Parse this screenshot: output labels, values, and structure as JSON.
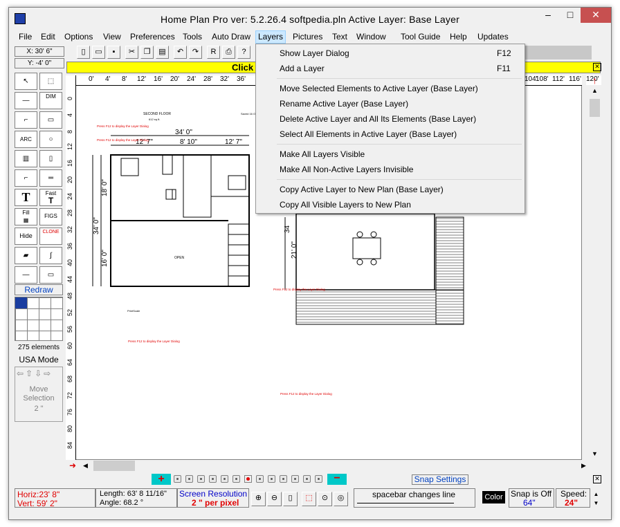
{
  "window": {
    "title": "Home Plan Pro ver: 5.2.26.4    softpedia.pln        Active Layer: Base Layer",
    "controls": {
      "minimize": "–",
      "maximize": "□",
      "close": "✕"
    }
  },
  "menu": [
    {
      "label": "File"
    },
    {
      "label": "Edit"
    },
    {
      "label": "Options"
    },
    {
      "label": "View"
    },
    {
      "label": "Preferences"
    },
    {
      "label": "Tools"
    },
    {
      "label": "Auto Draw"
    },
    {
      "label": "Layers"
    },
    {
      "label": "Pictures"
    },
    {
      "label": "Text"
    },
    {
      "label": "Window"
    },
    {
      "label": "Tool Guide"
    },
    {
      "label": "Help"
    },
    {
      "label": "Updates"
    }
  ],
  "coords": {
    "x": "X: 30' 6\"",
    "y": "Y: -4' 0\""
  },
  "banner": {
    "text": "Click o"
  },
  "layers_menu": [
    {
      "label": "Show Layer Dialog",
      "shortcut": "F12"
    },
    {
      "label": "Add a Layer",
      "shortcut": "F11"
    },
    {
      "label": "Move Selected Elements to Active Layer  (Base Layer)",
      "shortcut": ""
    },
    {
      "label": "Rename Active Layer     (Base Layer)",
      "shortcut": ""
    },
    {
      "label": "Delete Active Layer and All Its Elements     (Base Layer)",
      "shortcut": ""
    },
    {
      "label": "Select All Elements in Active Layer     (Base Layer)",
      "shortcut": ""
    },
    {
      "label": "Make All Layers Visible",
      "shortcut": ""
    },
    {
      "label": "Make All Non-Active Layers Invisible",
      "shortcut": ""
    },
    {
      "label": "Copy Active Layer to New Plan     (Base Layer)",
      "shortcut": ""
    },
    {
      "label": "Copy All Visible Layers to New Plan",
      "shortcut": ""
    }
  ],
  "ruler_h": [
    "0'",
    "4'",
    "8'",
    "12'",
    "16'",
    "20'",
    "24'",
    "28'",
    "32'",
    "36'",
    "104'",
    "108'",
    "112'",
    "116'",
    "120'"
  ],
  "ruler_v": [
    "0",
    "4",
    "8",
    "12",
    "16",
    "20",
    "24",
    "28",
    "32",
    "36",
    "40",
    "44",
    "48",
    "52",
    "56",
    "60",
    "64",
    "68",
    "72",
    "76",
    "80",
    "84"
  ],
  "palette": {
    "dim": "DIM",
    "arc": "ARC",
    "fast": "Fast",
    "fill": "Fill",
    "figs": "FIGS",
    "hide": "Hide",
    "clone": "CLONE",
    "redraw": "Redraw",
    "elements": "275 elements",
    "mode": "USA Mode",
    "move_selection": "Move Selection",
    "move_amount": "2 \""
  },
  "plan": {
    "second_floor": "SECOND FLOOR",
    "sqft": "612 sq ft.",
    "saved": "Saved 16 O",
    "open": "OPEN",
    "print_scale": "PrintScale",
    "hint": "Press  F12  to display the Layer Dialog",
    "dims": {
      "d34_top": "34' 0\"",
      "d12_7a": "12' 7\"",
      "d8_10": "8' 10\"",
      "d12_7b": "12' 7\"",
      "d18": "18' 0\"",
      "d34_left": "34' 0\"",
      "d16": "16' 0\"",
      "d34_right": "34",
      "d21": "21' 0\""
    }
  },
  "bottom": {
    "snap_settings": "Snap Settings",
    "horiz": "Horiz:23' 8\"",
    "vert": "Vert: 59' 2\"",
    "length": "Length: 63' 8 11/16\"",
    "angle": "Angle:  68.2 °",
    "screen_res": "Screen Resolution",
    "per_pixel": "2 \" per pixel",
    "spacebar": "spacebar changes line",
    "color": "Color",
    "snap_is": "Snap is Off",
    "snap_val": "64\"",
    "speed": "Speed:",
    "speed_val": "24\""
  }
}
